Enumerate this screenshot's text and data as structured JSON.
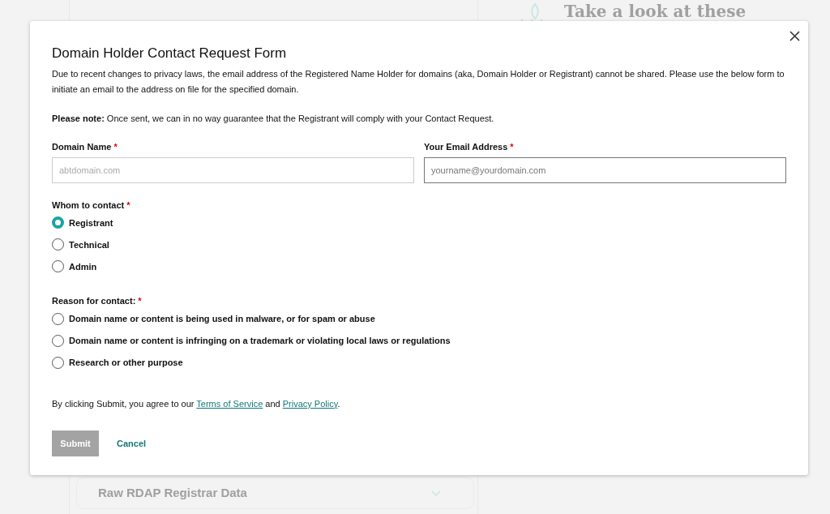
{
  "background": {
    "heading": "Take a look at these",
    "accordion_title": "Raw RDAP Registrar Data"
  },
  "dialog": {
    "title": "Domain Holder Contact Request Form",
    "intro": "Due to recent changes to privacy laws, the email address of the Registered Name Holder for domains (aka, Domain Holder or Registrant) cannot be shared. Please use the below form to initiate an email to the address on file for the specified domain.",
    "note": "**Please note:** Once sent, we can in no way guarantee that the Registrant will comply with your Contact Request.",
    "required_mark": "*",
    "fields": [
      {
        "label": "Domain Name",
        "required": true,
        "placeholder": "abtdomain.com",
        "focused": false
      },
      {
        "label": "Your Email Address",
        "required": true,
        "placeholder": "yourname@yourdomain.com",
        "focused": true
      }
    ],
    "radio_groups": [
      {
        "label": "Whom to contact",
        "required": true,
        "options": [
          {
            "label": "Registrant",
            "selected": true
          },
          {
            "label": "Technical",
            "selected": false
          },
          {
            "label": "Admin",
            "selected": false
          }
        ]
      },
      {
        "label": "Reason for contact:",
        "required": true,
        "options": [
          {
            "label": "Domain name or content is being used in malware, or for spam or abuse",
            "selected": false
          },
          {
            "label": "Domain name or content is infringing on a trademark or violating local laws or regulations",
            "selected": false
          },
          {
            "label": "Research or other purpose",
            "selected": false
          }
        ]
      }
    ],
    "consent": [
      {
        "kind": "text",
        "text": "By clicking Submit, you agree to our "
      },
      {
        "kind": "link",
        "text": "Terms of Service"
      },
      {
        "kind": "text",
        "text": " and "
      },
      {
        "kind": "link",
        "text": "Privacy Policy"
      },
      {
        "kind": "text",
        "text": "."
      }
    ],
    "submit": {
      "label": "Submit",
      "disabled": true
    },
    "cancel": {
      "label": "Cancel"
    }
  }
}
